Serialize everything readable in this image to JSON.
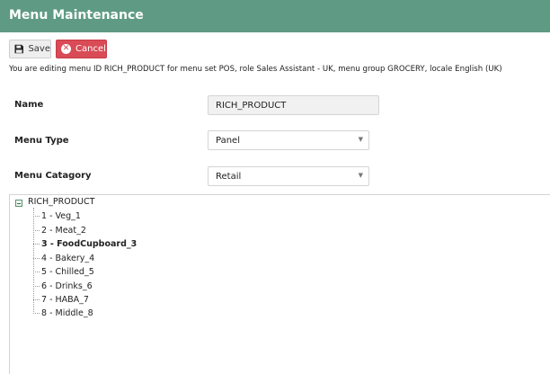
{
  "header": {
    "title": "Menu Maintenance"
  },
  "toolbar": {
    "save_label": "Save",
    "cancel_label": "Cancel"
  },
  "info_text": "You are editing menu ID RICH_PRODUCT for menu set POS, role Sales Assistant - UK, menu group GROCERY, locale English (UK)",
  "form": {
    "name_label": "Name",
    "name_value": "RICH_PRODUCT",
    "menu_type_label": "Menu Type",
    "menu_type_value": "Panel",
    "menu_category_label": "Menu Catagory",
    "menu_category_value": "Retail"
  },
  "tree": {
    "root": "RICH_PRODUCT",
    "items": [
      {
        "label": "1 - Veg_1",
        "selected": false
      },
      {
        "label": "2 - Meat_2",
        "selected": false
      },
      {
        "label": "3 - FoodCupboard_3",
        "selected": true
      },
      {
        "label": "4 - Bakery_4",
        "selected": false
      },
      {
        "label": "5 - Chilled_5",
        "selected": false
      },
      {
        "label": "6 - Drinks_6",
        "selected": false
      },
      {
        "label": "7 - HABA_7",
        "selected": false
      },
      {
        "label": "8 - Middle_8",
        "selected": false
      }
    ]
  },
  "colors": {
    "header": "#5f9b84",
    "cancel": "#d94b56"
  },
  "icons": {
    "save": "floppy-disk-icon",
    "cancel": "x-circle-icon",
    "dropdown": "caret-down-icon",
    "tree_toggle": "minus-box-icon"
  }
}
